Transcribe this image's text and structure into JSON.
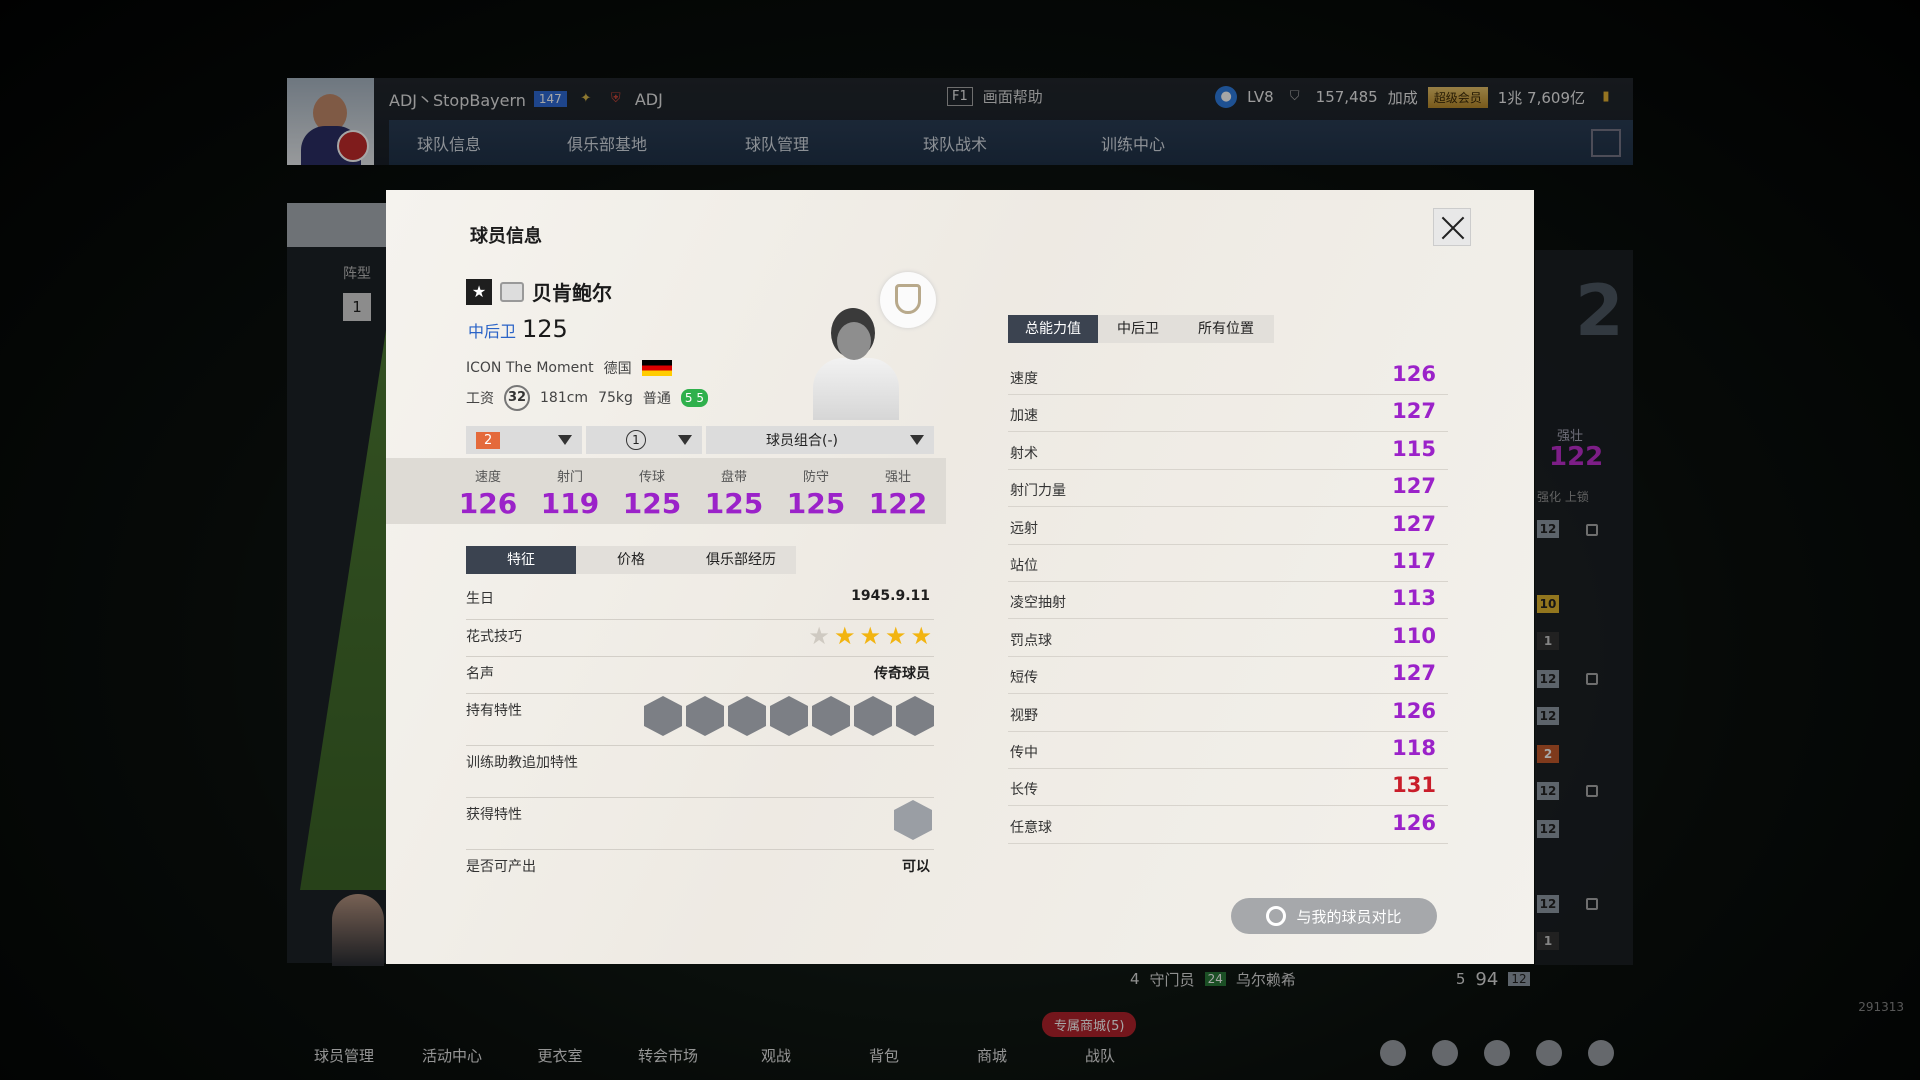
{
  "header": {
    "username": "ADJ丶StopBayern",
    "level_badge": "147",
    "club_name": "ADJ",
    "help_key": "F1",
    "help_label": "画面帮助",
    "account_level": "LV8",
    "points": "157,485",
    "bonus_label": "加成",
    "vip_label": "超级会员",
    "currency": "1兆 7,609亿",
    "nav": [
      "球队信息",
      "俱乐部基地",
      "球队管理",
      "球队战术",
      "训练中心"
    ]
  },
  "background": {
    "formation_label": "阵型",
    "formation_num": "1",
    "right_big_num": "2",
    "right_strong_label": "强壮",
    "right_strong_value": "122",
    "right_hdr": "强化  上锁",
    "slots": [
      "12",
      "10",
      "1",
      "12",
      "12",
      "2",
      "12",
      "12",
      "12",
      "1",
      "12"
    ],
    "bottom_strip": {
      "num1": "4",
      "pos": "守门员",
      "num2": "24",
      "name": "乌尔赖希",
      "num3": "5",
      "ovr": "94",
      "slot": "12"
    }
  },
  "modal": {
    "title": "球员信息",
    "player_name": "贝肯鲍尔",
    "position": "中后卫",
    "overall": "125",
    "season": "ICON The Moment",
    "nation": "德国",
    "wage_label": "工资",
    "wage": "32",
    "height": "181cm",
    "weight": "75kg",
    "body_type": "普通",
    "feet": "5 5",
    "selectors": {
      "level": "2",
      "rank": "1",
      "combo": "球员组合(-)"
    },
    "attributes": [
      {
        "label": "速度",
        "value": "126"
      },
      {
        "label": "射门",
        "value": "119"
      },
      {
        "label": "传球",
        "value": "125"
      },
      {
        "label": "盘带",
        "value": "125"
      },
      {
        "label": "防守",
        "value": "125"
      },
      {
        "label": "强壮",
        "value": "122"
      }
    ],
    "left_tabs": [
      "特征",
      "价格",
      "俱乐部经历"
    ],
    "birthday_label": "生日",
    "birthday": "1945.9.11",
    "skill_label": "花式技巧",
    "skill_stars": 4,
    "fame_label": "名声",
    "fame": "传奇球员",
    "traits_label": "持有特性",
    "coach_traits_label": "训练助教追加特性",
    "acquired_traits_label": "获得特性",
    "producible_label": "是否可产出",
    "producible": "可以",
    "right_tabs": [
      "总能力值",
      "中后卫",
      "所有位置"
    ],
    "stats": [
      {
        "name": "速度",
        "value": "126"
      },
      {
        "name": "加速",
        "value": "127"
      },
      {
        "name": "射术",
        "value": "115"
      },
      {
        "name": "射门力量",
        "value": "127"
      },
      {
        "name": "远射",
        "value": "127"
      },
      {
        "name": "站位",
        "value": "117"
      },
      {
        "name": "凌空抽射",
        "value": "113"
      },
      {
        "name": "罚点球",
        "value": "110"
      },
      {
        "name": "短传",
        "value": "127"
      },
      {
        "name": "视野",
        "value": "126"
      },
      {
        "name": "传中",
        "value": "118"
      },
      {
        "name": "长传",
        "value": "131"
      },
      {
        "name": "任意球",
        "value": "126"
      }
    ],
    "compare_label": "与我的球员对比",
    "compare_icon_label": "对比"
  },
  "bottombar": {
    "items": [
      "球员管理",
      "活动中心",
      "更衣室",
      "转会市场",
      "观战",
      "背包",
      "商城",
      "战队"
    ],
    "special_shop": "专属商城(5)"
  },
  "watermark": "291313"
}
